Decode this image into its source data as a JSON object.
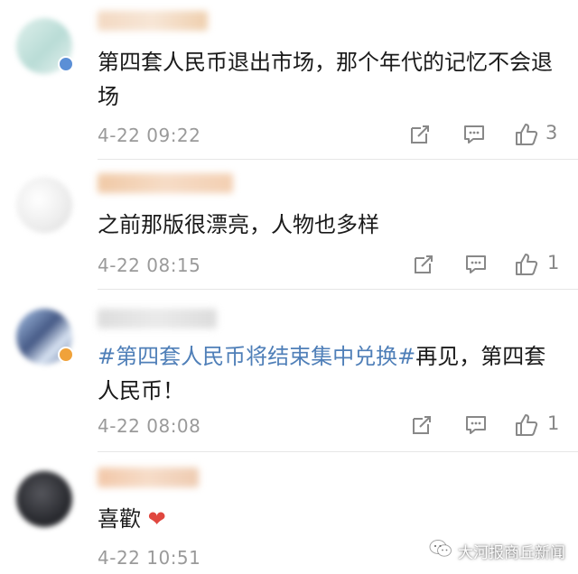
{
  "comments": [
    {
      "text": "第四套人民币退出市场，那个年代的记忆不会退场",
      "time": "4-22 09:22",
      "likes": "3",
      "avatar_color": "#cfe7e2",
      "verified_color": "#5b8fd6"
    },
    {
      "text": "之前那版很漂亮，人物也多样",
      "time": "4-22 08:15",
      "likes": "1",
      "avatar_color": "#e9e9e9"
    },
    {
      "topic": "#第四套人民币将结束集中兑换#",
      "text": "再见，第四套人民币！",
      "time": "4-22 08:08",
      "likes": "1",
      "avatar_color": "#7c8fb3",
      "verified_color": "#f0a23a"
    },
    {
      "text": "喜歡",
      "emoji": "❤",
      "time": "4-22 10:51",
      "avatar_color": "#2f3036"
    }
  ],
  "watermark": {
    "text": "大河报商丘新闻",
    "icon": "wechat-icon"
  },
  "icons": {
    "repost": "repost-icon",
    "comment": "comment-icon",
    "like": "thumbs-up-icon"
  }
}
